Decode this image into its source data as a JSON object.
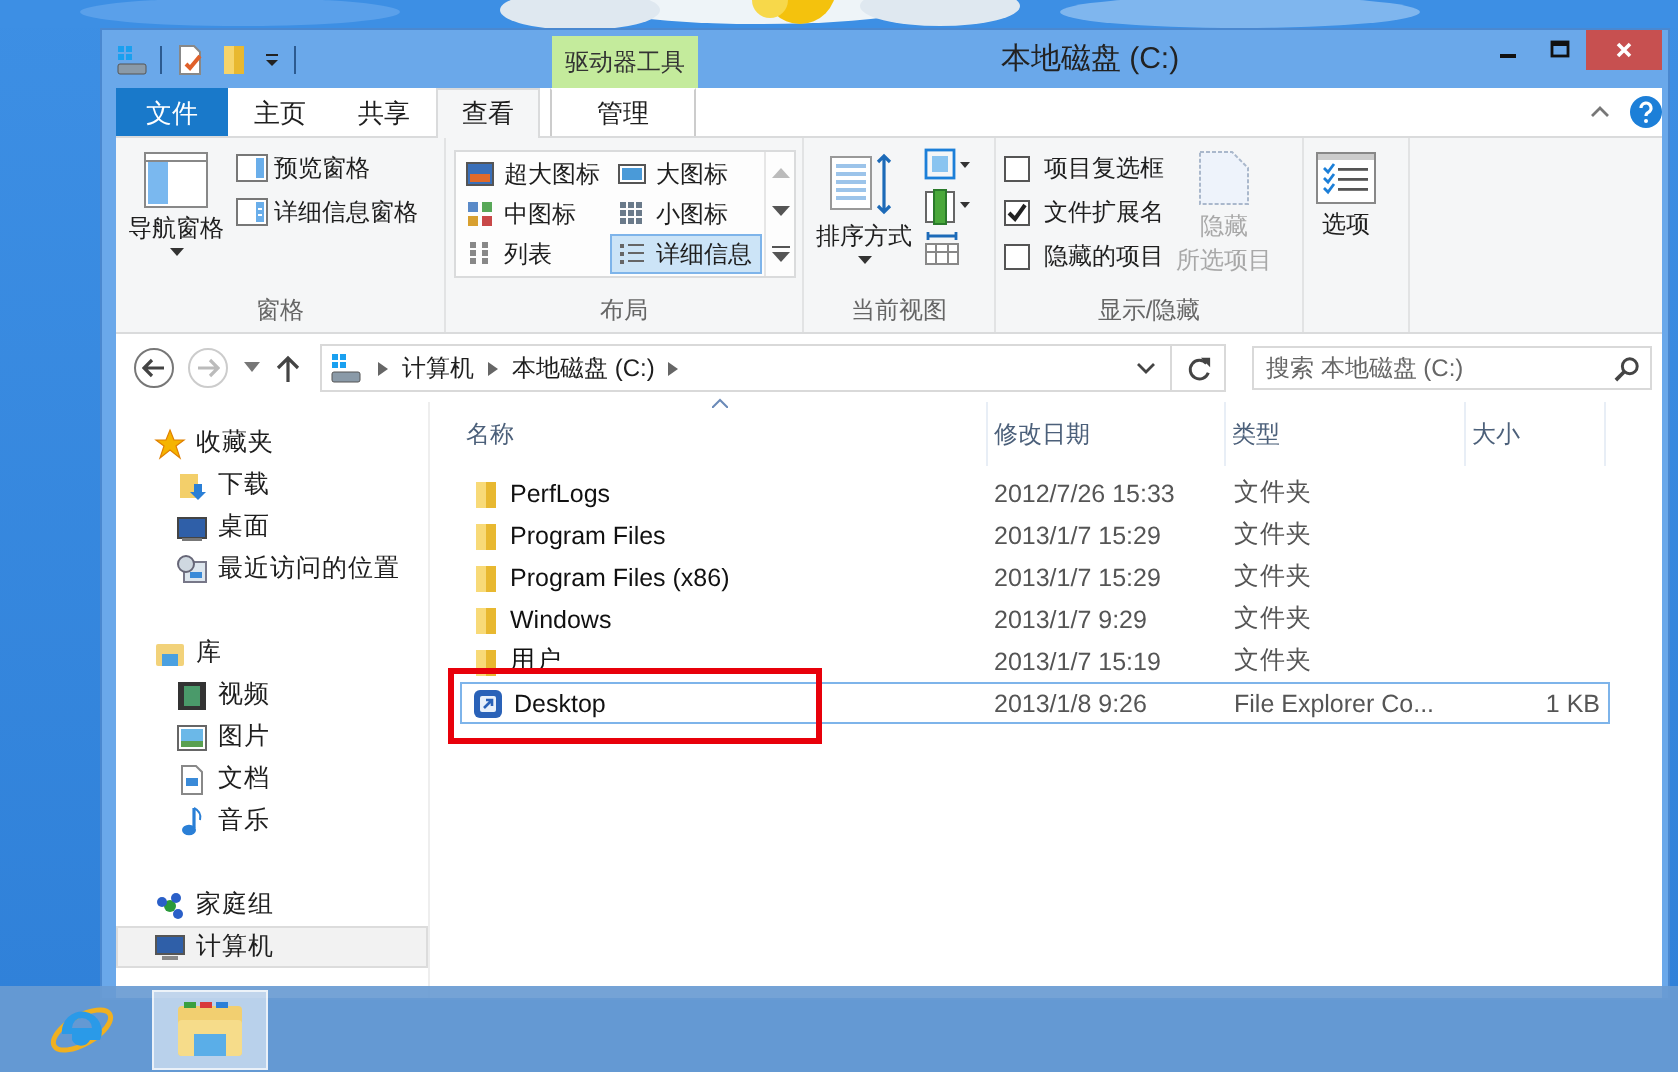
{
  "window": {
    "title": "本地磁盘 (C:)"
  },
  "context_tab": {
    "label": "驱动器工具"
  },
  "tabs": [
    {
      "label": "文件",
      "kind": "file",
      "selected": false
    },
    {
      "label": "主页",
      "kind": "normal",
      "selected": false
    },
    {
      "label": "共享",
      "kind": "normal",
      "selected": false
    },
    {
      "label": "查看",
      "kind": "normal",
      "selected": true
    },
    {
      "label": "管理",
      "kind": "context",
      "selected": false
    }
  ],
  "ribbon": {
    "panes": {
      "label": "窗格",
      "nav_pane": "导航窗格",
      "preview_pane": "预览窗格",
      "details_pane": "详细信息窗格"
    },
    "layout": {
      "label": "布局",
      "options": [
        {
          "label": "超大图标",
          "selected": false
        },
        {
          "label": "大图标",
          "selected": false
        },
        {
          "label": "中图标",
          "selected": false
        },
        {
          "label": "小图标",
          "selected": false
        },
        {
          "label": "列表",
          "selected": false
        },
        {
          "label": "详细信息",
          "selected": true
        }
      ]
    },
    "current_view": {
      "label": "当前视图",
      "sort_by": "排序方式"
    },
    "show_hide": {
      "label": "显示/隐藏",
      "checkboxes": [
        {
          "label": "项目复选框",
          "checked": false
        },
        {
          "label": "文件扩展名",
          "checked": true
        },
        {
          "label": "隐藏的项目",
          "checked": false
        }
      ],
      "hide_selected": {
        "lines": [
          "隐藏",
          "所选项目"
        ],
        "disabled": true
      }
    },
    "options": {
      "label": "选项"
    }
  },
  "address_bar": {
    "segments": [
      "计算机",
      "本地磁盘 (C:)"
    ]
  },
  "search": {
    "placeholder": "搜索 本地磁盘 (C:)"
  },
  "nav_pane": [
    {
      "label": "收藏夹",
      "kind": "favorites",
      "selected": false,
      "children": [
        {
          "label": "下载",
          "kind": "downloads",
          "selected": false
        },
        {
          "label": "桌面",
          "kind": "desktop",
          "selected": false
        },
        {
          "label": "最近访问的位置",
          "kind": "recent",
          "selected": false
        }
      ]
    },
    {
      "label": "库",
      "kind": "libraries",
      "selected": false,
      "children": [
        {
          "label": "视频",
          "kind": "videos",
          "selected": false
        },
        {
          "label": "图片",
          "kind": "pictures",
          "selected": false
        },
        {
          "label": "文档",
          "kind": "documents",
          "selected": false
        },
        {
          "label": "音乐",
          "kind": "music",
          "selected": false
        }
      ]
    },
    {
      "label": "家庭组",
      "kind": "homegroup",
      "selected": false
    },
    {
      "label": "计算机",
      "kind": "computer",
      "selected": true
    }
  ],
  "file_list": {
    "columns": [
      {
        "label": "名称",
        "sorted": true
      },
      {
        "label": "修改日期",
        "sorted": false
      },
      {
        "label": "类型",
        "sorted": false
      },
      {
        "label": "大小",
        "sorted": false
      }
    ],
    "rows": [
      {
        "name": "PerfLogs",
        "date": "2012/7/26 15:33",
        "type": "文件夹",
        "kind": "folder",
        "selected": false
      },
      {
        "name": "Program Files",
        "date": "2013/1/7 15:29",
        "type": "文件夹",
        "kind": "folder",
        "selected": false
      },
      {
        "name": "Program Files (x86)",
        "date": "2013/1/7 15:29",
        "type": "文件夹",
        "kind": "folder",
        "selected": false
      },
      {
        "name": "Windows",
        "date": "2013/1/7 9:29",
        "type": "文件夹",
        "kind": "folder",
        "selected": false
      },
      {
        "name": "用户",
        "date": "2013/1/7 15:19",
        "type": "文件夹",
        "kind": "folder",
        "selected": false
      },
      {
        "name": "Desktop",
        "date": "2013/1/8 9:26",
        "type": "File Explorer Co...",
        "size": "1 KB",
        "kind": "shortcut",
        "selected": true
      }
    ]
  },
  "taskbar": {
    "items": [
      {
        "kind": "browser",
        "selected": false
      },
      {
        "kind": "explorer",
        "selected": true
      }
    ]
  }
}
